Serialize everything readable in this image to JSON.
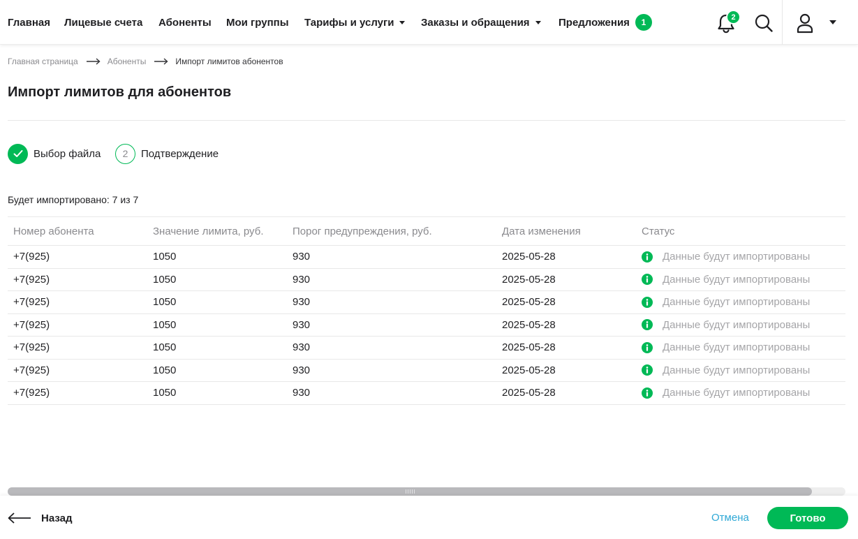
{
  "nav": {
    "items": [
      {
        "label": "Главная",
        "dropdown": false
      },
      {
        "label": "Лицевые счета",
        "dropdown": false
      },
      {
        "label": "Абоненты",
        "dropdown": false
      },
      {
        "label": "Мои группы",
        "dropdown": false
      },
      {
        "label": "Тарифы и услуги",
        "dropdown": true
      },
      {
        "label": "Заказы и обращения",
        "dropdown": true
      },
      {
        "label": "Предложения",
        "dropdown": false,
        "badge": "1"
      }
    ],
    "notifications_count": "2",
    "icons": {
      "notifications": "bell-icon",
      "search": "search-icon",
      "user": "user-icon",
      "user_menu": "chevron-down-icon"
    }
  },
  "breadcrumb": {
    "items": [
      "Главная страница",
      "Абоненты",
      "Импорт лимитов абонентов"
    ]
  },
  "page": {
    "title": "Импорт лимитов для абонентов",
    "steps": [
      {
        "label": "Выбор файла",
        "state": "done"
      },
      {
        "label": "Подтверждение",
        "state": "current",
        "number": "2"
      }
    ],
    "summary": "Будет импортировано: 7 из 7"
  },
  "table": {
    "columns": [
      "Номер абонента",
      "Значение лимита, руб.",
      "Порог предупреждения, руб.",
      "Дата изменения",
      "Статус"
    ],
    "rows": [
      {
        "phone": "+7(925)",
        "limit": "1050",
        "threshold": "930",
        "date": "2025-05-28",
        "status": "Данные будут импортированы"
      },
      {
        "phone": "+7(925)",
        "limit": "1050",
        "threshold": "930",
        "date": "2025-05-28",
        "status": "Данные будут импортированы"
      },
      {
        "phone": "+7(925)",
        "limit": "1050",
        "threshold": "930",
        "date": "2025-05-28",
        "status": "Данные будут импортированы"
      },
      {
        "phone": "+7(925)",
        "limit": "1050",
        "threshold": "930",
        "date": "2025-05-28",
        "status": "Данные будут импортированы"
      },
      {
        "phone": "+7(925)",
        "limit": "1050",
        "threshold": "930",
        "date": "2025-05-28",
        "status": "Данные будут импортированы"
      },
      {
        "phone": "+7(925)",
        "limit": "1050",
        "threshold": "930",
        "date": "2025-05-28",
        "status": "Данные будут импортированы"
      },
      {
        "phone": "+7(925)",
        "limit": "1050",
        "threshold": "930",
        "date": "2025-05-28",
        "status": "Данные будут импортированы"
      }
    ],
    "status_icon": "info-icon"
  },
  "footer": {
    "back_label": "Назад",
    "cancel_label": "Отмена",
    "done_label": "Готово"
  },
  "colors": {
    "accent": "#00b956",
    "link": "#2ea8d6",
    "text": "#1f1f22",
    "muted": "#8a8a8e"
  }
}
